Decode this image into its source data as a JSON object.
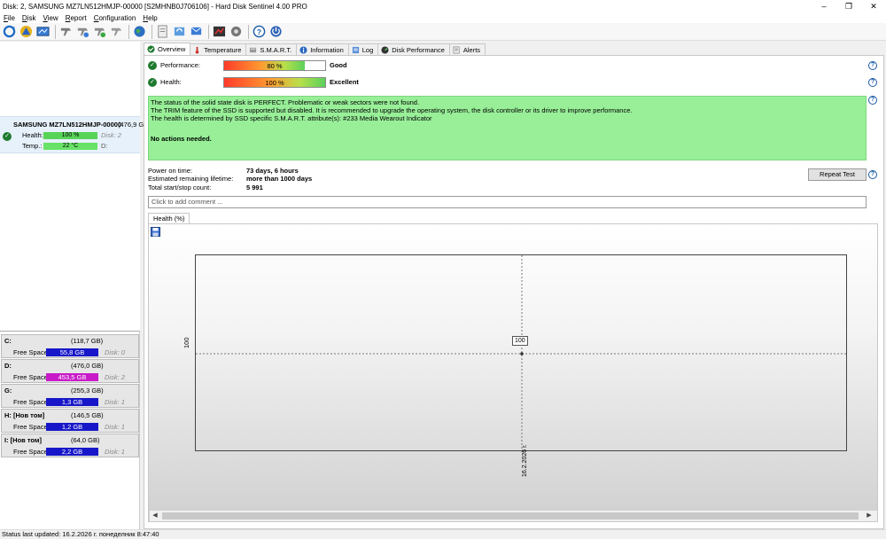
{
  "window": {
    "title": "Disk: 2, SAMSUNG MZ7LN512HMJP-00000 [S2MHNB0J706106]  -  Hard Disk Sentinel 4.00 PRO",
    "minimize": "‒",
    "maximize": "❐",
    "close": "✕"
  },
  "menu": [
    "File",
    "Disk",
    "View",
    "Report",
    "Configuration",
    "Help"
  ],
  "toolbar_icons": [
    "refresh-icon",
    "warning-icon",
    "disk-details-icon",
    "probe-icon",
    "probe-icon-2",
    "probe-icon-3",
    "probe-icon-4",
    "globe-icon",
    "document-icon",
    "sync-icon",
    "send-icon",
    "report-icon",
    "settings-disk-icon",
    "help-icon",
    "power-icon"
  ],
  "disk_panel": {
    "name": "SAMSUNG MZ7LN512HMJP-00000",
    "size": "(476,9 G",
    "health_label": "Health:",
    "health_value": "100 %",
    "health_percent": 100,
    "disk_ref": "Disk: 2",
    "temp_label": "Temp.:",
    "temp_value": "22 °C",
    "temp_ref": "D:"
  },
  "volumes": [
    {
      "letter": "C:",
      "size": "(118,7 GB)",
      "free_label": "Free Space",
      "free": "55,8 GB",
      "disk": "Disk: 0",
      "color": "#1717c9"
    },
    {
      "letter": "D:",
      "size": "(476,0 GB)",
      "free_label": "Free Space",
      "free": "453,5 GB",
      "disk": "Disk: 2",
      "color": "#c81ac8"
    },
    {
      "letter": "G:",
      "size": "(255,3 GB)",
      "free_label": "Free Space",
      "free": "1,3 GB",
      "disk": "Disk: 1",
      "color": "#1717c9"
    },
    {
      "letter": "H: [Нов том]",
      "size": "(146,5 GB)",
      "free_label": "Free Space",
      "free": "1,2 GB",
      "disk": "Disk: 1",
      "color": "#1717c9"
    },
    {
      "letter": "I: [Нов том]",
      "size": "(64,0 GB)",
      "free_label": "Free Space",
      "free": "2,2 GB",
      "disk": "Disk: 1",
      "color": "#1717c9"
    }
  ],
  "tabs": [
    {
      "label": "Overview",
      "icon": "check-icon"
    },
    {
      "label": "Temperature",
      "icon": "thermometer-icon"
    },
    {
      "label": "S.M.A.R.T.",
      "icon": "smart-icon"
    },
    {
      "label": "Information",
      "icon": "info-icon"
    },
    {
      "label": "Log",
      "icon": "log-icon"
    },
    {
      "label": "Disk Performance",
      "icon": "performance-icon"
    },
    {
      "label": "Alerts",
      "icon": "alerts-icon"
    }
  ],
  "overview": {
    "performance_label": "Performance:",
    "performance_value": "80 %",
    "performance_percent": 80,
    "performance_rating": "Good",
    "health_label": "Health:",
    "health_value": "100 %",
    "health_percent": 100,
    "health_rating": "Excellent",
    "status_lines": [
      "The status of the solid state disk is PERFECT. Problematic or weak sectors were not found.",
      "The TRIM feature of the SSD is supported but disabled. It is recommended to upgrade the operating system, the disk controller or its driver to improve performance.",
      "The health is determined by SSD specific S.M.A.R.T. attribute(s):  #233 Media Wearout Indicator"
    ],
    "status_action": "No actions needed.",
    "power_on_label": "Power on time:",
    "power_on_value": "73 days, 6 hours",
    "lifetime_label": "Estimated remaining lifetime:",
    "lifetime_value": "more than 1000 days",
    "startstop_label": "Total start/stop count:",
    "startstop_value": "5 991",
    "repeat_test": "Repeat Test",
    "comment_placeholder": "Click to add comment ..."
  },
  "chart_tab": "Health (%)",
  "chart_data": {
    "type": "line",
    "x": [
      "16.2.2026 г."
    ],
    "series": [
      {
        "values": [
          100
        ]
      }
    ],
    "ytick": "100",
    "point_label": "100",
    "xtick": "16.2.2026 г."
  },
  "status_bar": "Status last updated: 16.2.2026 г. понеделник 8:47:40"
}
